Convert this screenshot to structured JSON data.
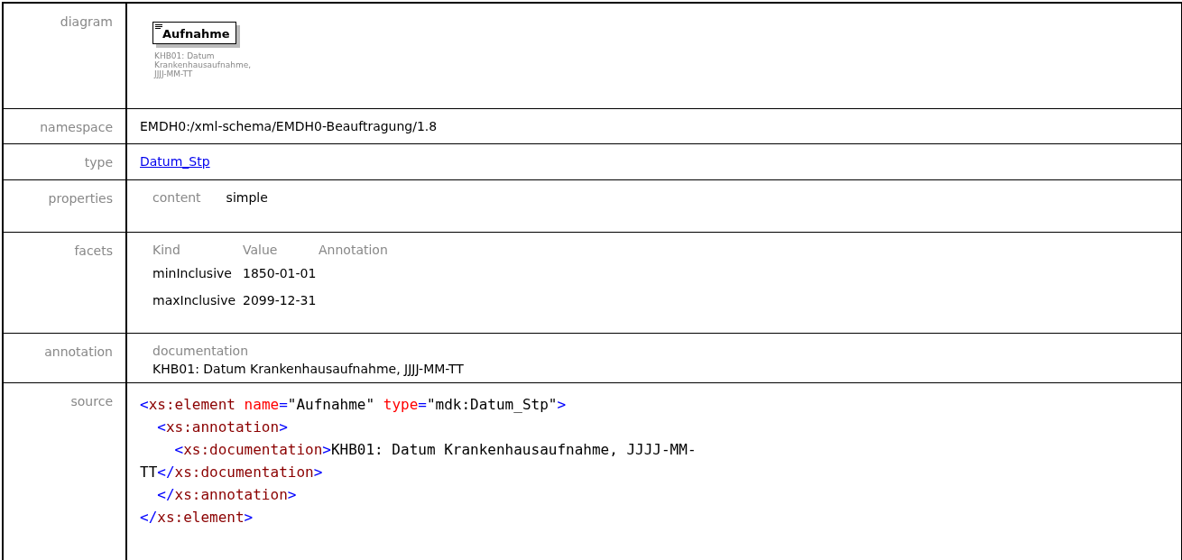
{
  "rows": [
    {
      "kind": "diagram",
      "label": "diagram",
      "element": "Aufnahme",
      "caption_lines": [
        "KHB01: Datum",
        "Krankenhausaufnahme,",
        "JJJJ-MM-TT"
      ]
    },
    {
      "kind": "text",
      "label": "namespace",
      "value": "EMDH0:/xml-schema/EMDH0-Beauftragung/1.8"
    },
    {
      "kind": "link",
      "label": "type",
      "value": "Datum_Stp"
    },
    {
      "kind": "properties",
      "label": "properties",
      "items": [
        {
          "name": "content",
          "value": "simple"
        }
      ]
    },
    {
      "kind": "facets",
      "label": "facets",
      "columns": [
        "Kind",
        "Value",
        "Annotation"
      ],
      "facets": [
        {
          "kind": "minInclusive",
          "value": "1850-01-01"
        },
        {
          "kind": "maxInclusive",
          "value": "2099-12-31"
        }
      ]
    },
    {
      "kind": "annotation",
      "label": "annotation",
      "heading": "documentation",
      "value": "KHB01: Datum Krankenhausaufnahme, JJJJ-MM-TT"
    },
    {
      "kind": "source",
      "label": "source",
      "lines": [
        {
          "kind": "top",
          "tokens": [
            {
              "kind": "bracket",
              "text": "<"
            },
            {
              "kind": "tag",
              "text": "xs:element "
            },
            {
              "kind": "attr",
              "text": "name"
            },
            {
              "kind": "bracket",
              "text": "="
            },
            {
              "kind": "plain",
              "text": "\"Aufnahme\" "
            },
            {
              "kind": "attr",
              "text": "type"
            },
            {
              "kind": "bracket",
              "text": "="
            },
            {
              "kind": "plain",
              "text": "\"mdk:Datum_Stp\""
            },
            {
              "kind": "bracket",
              "text": ">"
            }
          ]
        },
        {
          "kind": "nested",
          "tokens": [
            {
              "kind": "bracket",
              "text": "<"
            },
            {
              "kind": "tag",
              "text": "xs:annotation"
            },
            {
              "kind": "bracket",
              "text": ">"
            }
          ]
        },
        {
          "kind": "nested2",
          "tokens": [
            {
              "kind": "bracket",
              "text": "<"
            },
            {
              "kind": "tag",
              "text": "xs:documentation"
            },
            {
              "kind": "bracket",
              "text": ">"
            },
            {
              "kind": "plain",
              "text": "KHB01: Datum Krankenhausaufnahme, JJJJ-MM-"
            }
          ]
        },
        {
          "kind": "top",
          "tokens": [
            {
              "kind": "plain",
              "text": "TT"
            },
            {
              "kind": "bracket",
              "text": "</"
            },
            {
              "kind": "tag",
              "text": "xs:documentation"
            },
            {
              "kind": "bracket",
              "text": ">"
            }
          ]
        },
        {
          "kind": "nested",
          "tokens": [
            {
              "kind": "bracket",
              "text": "</"
            },
            {
              "kind": "tag",
              "text": "xs:annotation"
            },
            {
              "kind": "bracket",
              "text": ">"
            }
          ]
        },
        {
          "kind": "top",
          "tokens": [
            {
              "kind": "bracket",
              "text": "</"
            },
            {
              "kind": "tag",
              "text": "xs:element"
            },
            {
              "kind": "bracket",
              "text": ">"
            }
          ]
        }
      ]
    }
  ]
}
